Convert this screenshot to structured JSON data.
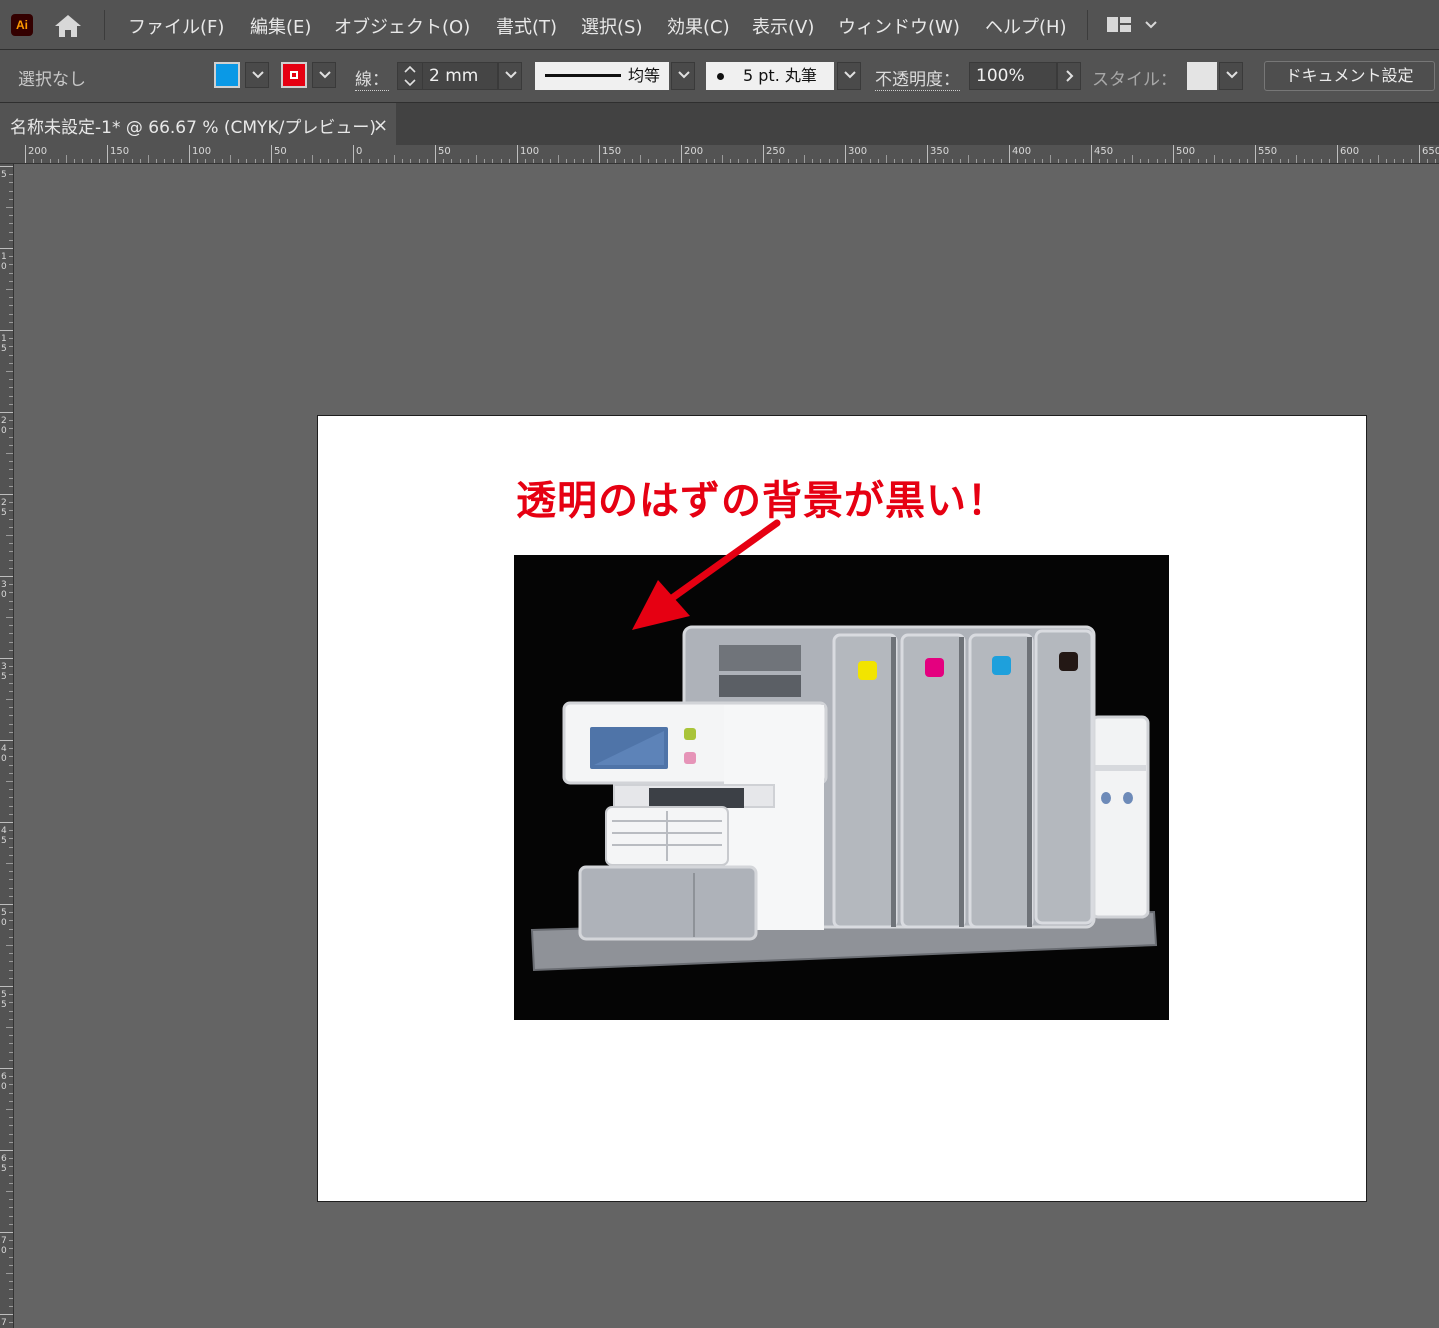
{
  "app": {
    "logo_text": "Ai",
    "menu": [
      "ファイル(F)",
      "編集(E)",
      "オブジェクト(O)",
      "書式(T)",
      "選択(S)",
      "効果(C)",
      "表示(V)",
      "ウィンドウ(W)",
      "ヘルプ(H)"
    ]
  },
  "control": {
    "selection_label": "選択なし",
    "fill_color": "#0a99e6",
    "stroke_color": "#e60012",
    "stroke_label": "線：",
    "stroke_weight": "2 mm",
    "profile_label": "均等",
    "brush_label": "5 pt. 丸筆",
    "opacity_label": "不透明度：",
    "opacity_value": "100%",
    "style_label": "スタイル：",
    "doc_settings_label": "ドキュメント設定"
  },
  "tab": {
    "title": "名称未設定-1* @ 66.67 % (CMYK/プレビュー)",
    "close_icon": "×"
  },
  "ruler": {
    "h_labels": [
      "200",
      "150",
      "100",
      "50",
      "0",
      "50",
      "100",
      "150",
      "200",
      "250",
      "300",
      "350",
      "400",
      "450",
      "500",
      "550",
      "600",
      "650"
    ],
    "v_labels": [
      "5",
      "1\n0",
      "1\n5",
      "2\n0",
      "2\n5",
      "3\n0",
      "3\n5",
      "4\n0",
      "4\n5",
      "5\n0",
      "5\n5",
      "6\n0",
      "6\n5",
      "7\n0",
      "7"
    ]
  },
  "artboard": {
    "annotation": "透明のはずの背景が黒い！",
    "annotation_color": "#e60012",
    "image_background": "#050505",
    "ink_colors": [
      "#f2e400",
      "#e4007f",
      "#1ea0dc",
      "#231815"
    ]
  }
}
